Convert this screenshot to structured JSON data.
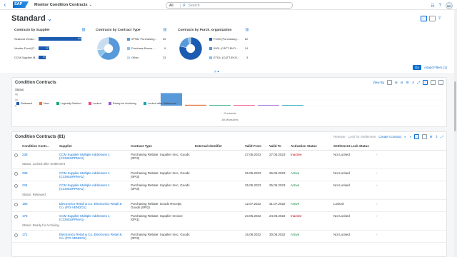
{
  "shell": {
    "back": "‹",
    "logo": "SAP",
    "title": "Monitor Condition Contracts",
    "search_scope": "All",
    "search_placeholder": "Search",
    "avatar": "MD"
  },
  "header": {
    "variant": "Standard",
    "go": "Go",
    "adapt": "Adapt Filters (1)"
  },
  "cards": {
    "supplier": {
      "title": "Contracts by Supplier",
      "items": [
        {
          "label": "Seafood Vendo...",
          "value": 44,
          "frac": 1.0
        },
        {
          "label": "Vendor Food (P...",
          "value": 12,
          "frac": 0.25
        },
        {
          "label": "CCM Supplier M...",
          "value": 5,
          "frac": 0.16
        }
      ]
    },
    "type": {
      "title": "Contracts by Contract Type",
      "items": [
        {
          "label": "0PSB: Purchasing...",
          "value": 53,
          "color": "#5899da"
        },
        {
          "label": "Purchase Bonus ...",
          "value": 9,
          "color": "#8cc1ea"
        },
        {
          "label": "Other",
          "value": 23,
          "color": "#c8ddf0"
        }
      ]
    },
    "org": {
      "title": "Contracts by Purch. organization",
      "items": [
        {
          "label": "FO20 (Purchasing...",
          "value": 62,
          "color": "#1b5bb0"
        },
        {
          "label": "0001 (CATT-EKO...",
          "value": 14,
          "color": "#5899da"
        },
        {
          "label": "ETDU (CATT-EKO...",
          "value": 3,
          "color": "#8cc1ea"
        }
      ]
    }
  },
  "cc_panel": {
    "title": "Condition Contracts",
    "view_by": "View By",
    "status": "Status",
    "x_label": "Contracts",
    "all_measures": "All Measures",
    "ticks": [
      "40",
      "20",
      "0"
    ],
    "legend": [
      {
        "label": "Released",
        "color": "#1b5bb0"
      },
      {
        "label": "New",
        "color": "#e8743b"
      },
      {
        "label": "Logically Deleted",
        "color": "#19a979"
      },
      {
        "label": "Locked",
        "color": "#ed4a7b"
      },
      {
        "label": "Ready for Archiving",
        "color": "#945ecf"
      },
      {
        "label": "Locked after Settlement",
        "color": "#13a4b4"
      }
    ],
    "bars": [
      {
        "value": 44,
        "color": "#5899da"
      },
      {
        "value": 3,
        "color": "#e8743b"
      },
      {
        "value": 2,
        "color": "#19a979"
      },
      {
        "value": 2,
        "color": "#ed4a7b"
      },
      {
        "value": 1,
        "color": "#945ecf"
      },
      {
        "value": 1,
        "color": "#13a4b4"
      }
    ]
  },
  "table": {
    "title": "Condition Contracts (81)",
    "actions": {
      "release": "Release",
      "lock": "Lock for Settlement",
      "create": "Create Contract"
    },
    "columns": [
      "Condition Contr...",
      "Supplier",
      "Contract Type",
      "External Identifier",
      "Valid From",
      "Valid To",
      "Activation Status",
      "Settlement Lock Status"
    ],
    "rows": [
      {
        "id": "238",
        "supplier": "CCM Supplier Multiple Addresses 1 (CCMSUPPMA1)",
        "type": "Purchasing Rebate: Supplier Invc, Goods (0PI3)",
        "ext": "",
        "from": "27.05.2023",
        "to": "27.05.2023",
        "act": "Inactive",
        "actc": "inact",
        "lock": "Not Locked",
        "sub": "Status:  Locked after Settlement"
      },
      {
        "id": "235",
        "supplier": "CCM Supplier Multiple Addresses 1 (CCMSUPPMA1)",
        "type": "Purchasing Rebate: Supplier Invc, Goods (0PI3)",
        "ext": "",
        "from": "26.05.2023",
        "to": "26.05.2023",
        "act": "Active",
        "actc": "act",
        "lock": "Not Locked",
        "sub": ""
      },
      {
        "id": "234",
        "supplier": "CCM Supplier Multiple Addresses 1 (CCMSUPPMA1)",
        "type": "Purchasing Rebate: Supplier Invc, Goods (0PI3)",
        "ext": "",
        "from": "25.05.2023",
        "to": "25.05.2023",
        "act": "Active",
        "actc": "act",
        "lock": "Not Locked",
        "sub": "Status:  Released"
      },
      {
        "id": "180",
        "supplier": "Electronics Retail & Co. Electronics Retail & Co. (PO-VENDO1)",
        "type": "Purchasing Rebate: Goods Receipt, Goods (0PI2)",
        "ext": "",
        "from": "12.07.2022",
        "to": "31.07.2022",
        "act": "Active",
        "actc": "act",
        "lock": "Locked",
        "sub": ""
      },
      {
        "id": "176",
        "supplier": "CCM Supplier Multiple Addresses 1 (CCMSUPPMA1)",
        "type": "Purchasing Rebate: Supplier Invoice (0PI1)",
        "ext": "",
        "from": "23.06.2022",
        "to": "24.06.2022",
        "act": "Inactive",
        "actc": "inact",
        "lock": "Not Locked",
        "sub": "Status:  Ready for Archiving"
      },
      {
        "id": "171",
        "supplier": "Electronics Retail & Co. Electronics Retail & Co. (PO-VENDO1)",
        "type": "Purchasing Rebate: Supplier Invc, Goods (0PI3)",
        "ext": "",
        "from": "16.06.2022",
        "to": "30.06.2022",
        "act": "Active",
        "actc": "act",
        "lock": "Not Locked",
        "sub": ""
      }
    ]
  }
}
